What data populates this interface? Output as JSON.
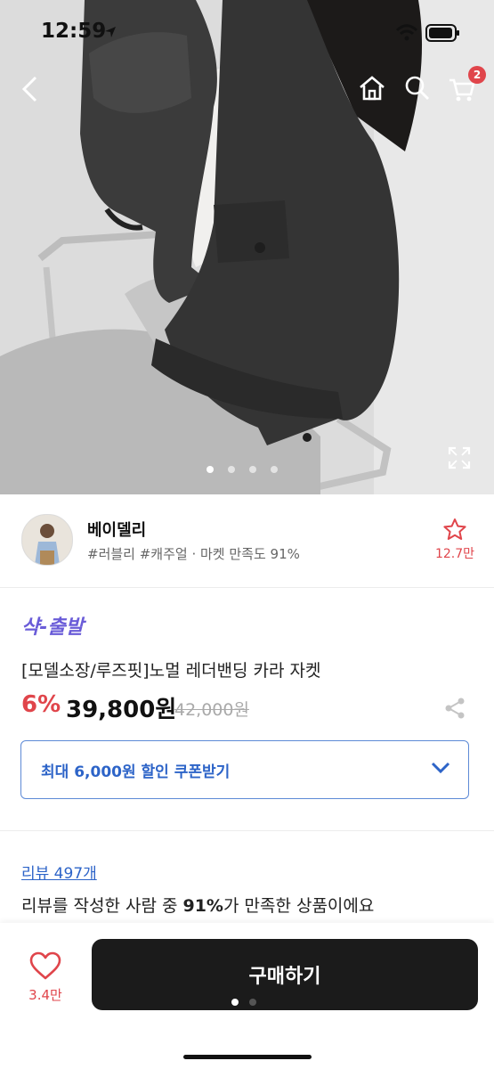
{
  "status_bar": {
    "time": "12:59"
  },
  "product_image": {
    "carousel_dots": 4,
    "active_index": 0
  },
  "header": {
    "cart_badge": "2"
  },
  "seller": {
    "name": "베이델리",
    "tags": "#러블리 #캐주얼 · 마켓 만족도 91%",
    "favorites_count": "12.7만"
  },
  "product": {
    "promo_tag": "샥-출발",
    "title": "[모델소장/루즈핏]노멀 레더밴딩 카라 자켓",
    "discount": "6%",
    "price": "39,800원",
    "original_price": "42,000원"
  },
  "coupon": {
    "label": "최대 6,000원 할인 쿠폰받기"
  },
  "reviews": {
    "link": "리뷰 497개",
    "summary_prefix": "리뷰를 작성한 사람 중 ",
    "summary_highlight": "91%",
    "summary_suffix": "가 만족한 상품이에요"
  },
  "bottom_bar": {
    "like_count": "3.4만",
    "buy_label": "구매하기"
  },
  "colors": {
    "accent_red": "#e0454b",
    "promo_purple": "#6a5cd8",
    "link_blue": "#2d64c8",
    "buy_bg": "#1b1b1b"
  }
}
